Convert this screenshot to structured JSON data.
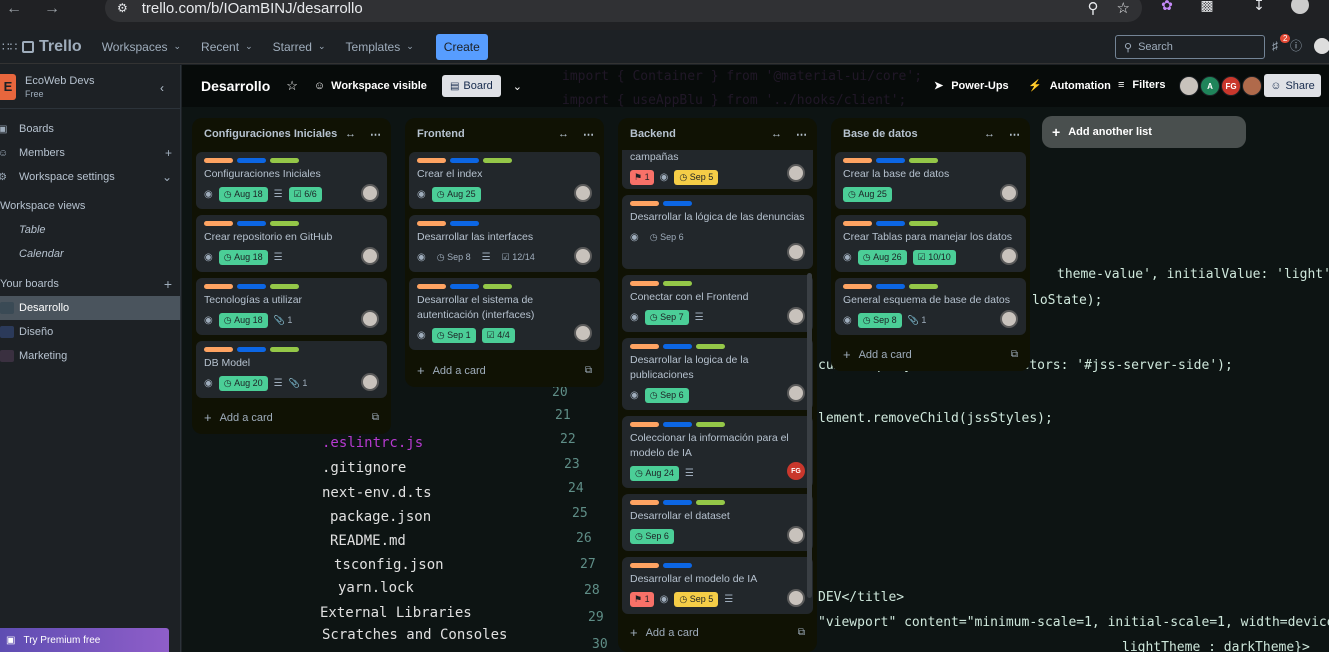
{
  "browser": {
    "url": "trello.com/b/IOamBINJ/desarrollo"
  },
  "header": {
    "app_name": "Trello",
    "menus": [
      {
        "label": "Workspaces"
      },
      {
        "label": "Recent"
      },
      {
        "label": "Starred"
      },
      {
        "label": "Templates"
      }
    ],
    "create_label": "Create",
    "search_placeholder": "Search",
    "notifications_count": "2"
  },
  "sidebar": {
    "workspace_name": "EcoWeb Devs",
    "workspace_plan": "Free",
    "workspace_initial": "E",
    "items": [
      {
        "label": "Boards"
      },
      {
        "label": "Members"
      },
      {
        "label": "Workspace settings"
      }
    ],
    "views_title": "Workspace views",
    "views": [
      {
        "label": "Table"
      },
      {
        "label": "Calendar"
      }
    ],
    "boards_title": "Your boards",
    "boards": [
      {
        "label": "Desarrollo"
      },
      {
        "label": "Diseño"
      },
      {
        "label": "Marketing"
      }
    ],
    "premium_label": "Try Premium free"
  },
  "board": {
    "title": "Desarrollo",
    "visibility": "Workspace visible",
    "view_label": "Board",
    "power_ups": "Power-Ups",
    "automation": "Automation",
    "filters": "Filters",
    "share": "Share",
    "member_initials": [
      "A",
      "FG"
    ],
    "add_list": "Add another list",
    "add_card": "Add a card"
  },
  "colors": {
    "label_orange": "#fea362",
    "label_blue": "#0c66e4",
    "label_green": "#94c748",
    "accent": "#579dff"
  },
  "lists": [
    {
      "title": "Configuraciones Iniciales",
      "cards": [
        {
          "title": "Configuraciones Iniciales",
          "date": "Aug 18",
          "checklist": "6/6"
        },
        {
          "title": "Crear repositorio en GitHub",
          "date": "Aug 18"
        },
        {
          "title": "Tecnologías a utilizar",
          "date": "Aug 18",
          "attachments": "1"
        },
        {
          "title": "DB Model",
          "date": "Aug 20",
          "attachments": "1"
        }
      ]
    },
    {
      "title": "Frontend",
      "cards": [
        {
          "title": "Crear el index",
          "date": "Aug 25"
        },
        {
          "title": "Desarrollar las interfaces",
          "date": "Sep 8",
          "checklist": "12/14"
        },
        {
          "title": "Desarrollar el sistema de autenticación (interfaces)",
          "date": "Sep 1",
          "checklist": "4/4"
        }
      ]
    },
    {
      "title": "Backend",
      "cards": [
        {
          "title": "campañas",
          "priority": "1",
          "date": "Sep 5"
        },
        {
          "title": "Desarrollar la lógica de las denuncias",
          "date": "Sep 6"
        },
        {
          "title": "Conectar con el Frontend",
          "date": "Sep 7"
        },
        {
          "title": "Desarrollar la logica de la publicaciones",
          "date": "Sep 6"
        },
        {
          "title": "Coleccionar la información para el modelo de IA",
          "date": "Aug 24",
          "member": "FG"
        },
        {
          "title": "Desarrollar el dataset",
          "date": "Sep 6"
        },
        {
          "title": "Desarrollar el modelo de IA",
          "priority": "1",
          "date": "Sep 5"
        }
      ]
    },
    {
      "title": "Base de datos",
      "cards": [
        {
          "title": "Crear la base de datos",
          "date": "Aug 25"
        },
        {
          "title": "Crear Tablas para manejar los datos",
          "date": "Aug 26",
          "checklist": "10/10"
        },
        {
          "title": "General esquema de base de datos",
          "date": "Sep 8",
          "attachments": "1"
        }
      ]
    }
  ],
  "background_code": {
    "line1": "import { Container } from '@material-ui/core';",
    "line2": "import { useAppBlu } from '../hooks/client';",
    "line3": "theme-value', initialValue: 'light')",
    "line4": "loState);",
    "line5": "cument.querySelector( selectors: '#jss-server-side');",
    "line6": "lement.removeChild(jssStyles);",
    "line7": "DEV</title>",
    "line8": "\"viewport\" content=\"minimum-scale=1, initial-scale=1, width=device",
    "line9": "lightTheme : darkTheme}>",
    "files": [
      ".eslintrc.js",
      ".gitignore",
      "next-env.d.ts",
      "package.json",
      "README.md",
      "tsconfig.json",
      "yarn.lock",
      "External Libraries",
      "Scratches and Consoles"
    ],
    "line_numbers": [
      "20",
      "21",
      "22",
      "23",
      "24",
      "25",
      "26",
      "27",
      "28",
      "29",
      "30"
    ]
  }
}
